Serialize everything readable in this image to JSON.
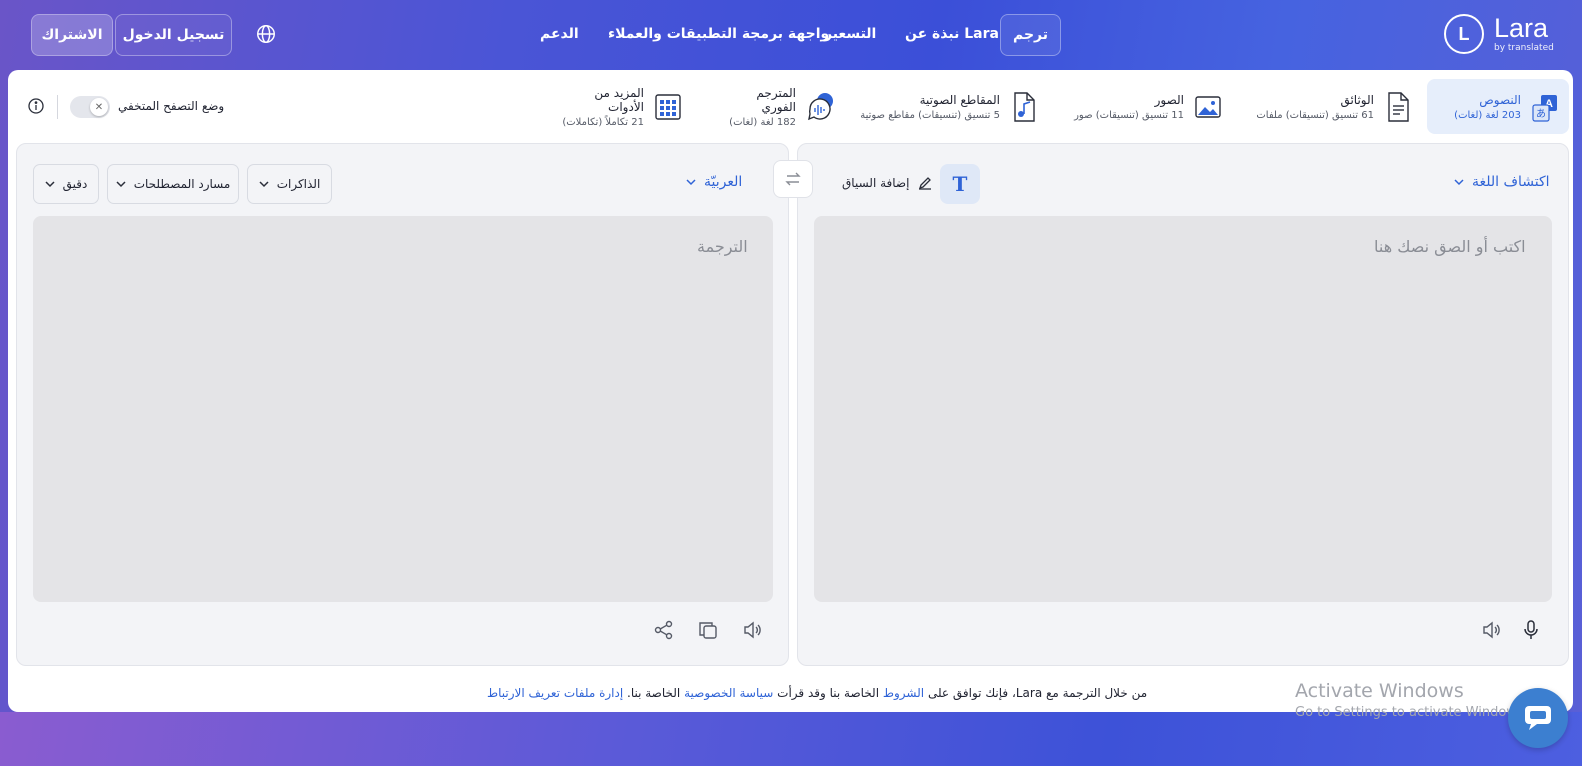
{
  "brand": {
    "logo_letter": "L",
    "name": "Lara",
    "tagline": "by translated"
  },
  "nav": {
    "translate": "ترجم",
    "about": "نبذة عن Lara",
    "pricing": "التسعير",
    "api": "واجهة برمجة التطبيقات والعملاء",
    "support": "الدعم",
    "login": "تسجيل الدخول",
    "subscribe": "الاشتراك"
  },
  "tools": [
    {
      "name": "النصوص",
      "sub": "203 لغة (لغات)",
      "icon": "text-translate-icon",
      "active": true
    },
    {
      "name": "الوثائق",
      "sub": "61 تنسيق (تنسيقات) ملفات",
      "icon": "document-icon",
      "active": false
    },
    {
      "name": "الصور",
      "sub": "11 تنسيق (تنسيقات) صور",
      "icon": "image-icon",
      "active": false
    },
    {
      "name": "المقاطع الصوتية",
      "sub": "5 تنسيق (تنسيقات) مقاطع صوتية",
      "icon": "audio-file-icon",
      "active": false
    },
    {
      "name": "المترجم الفوري",
      "sub": "182 لغة (لغات)",
      "icon": "voice-chat-icon",
      "active": false
    },
    {
      "name": "المزيد من الأدوات",
      "sub": "21 تكاملاً (تكاملات)",
      "icon": "grid-apps-icon",
      "active": false
    }
  ],
  "incognito": {
    "label": "وضع التصفح المتخفي",
    "enabled": false
  },
  "source": {
    "language": "اكتشاف اللغة",
    "placeholder": "اكتب أو الصق نصك هنا",
    "context_label": "إضافة السياق"
  },
  "target": {
    "language": "العربيّة",
    "placeholder": "الترجمة",
    "memories": "الذاكرات",
    "glossaries": "مسارد المصطلحات",
    "style": "دقيق"
  },
  "footer": {
    "part1": "من خلال الترجمة مع Lara، فإنك توافق على",
    "terms": "الشروط",
    "part2": "الخاصة بنا وقد قرأت",
    "privacy": "سياسة الخصوصية",
    "part3": "الخاصة بنا.",
    "cookies": "إدارة ملفات تعريف الارتباط"
  },
  "watermark": {
    "title": "Activate Windows",
    "subtitle": "Go to Settings to activate Windows."
  },
  "colors": {
    "accent": "#2f63d6",
    "header_start": "#6a55c8",
    "header_end": "#3b4fd8"
  }
}
